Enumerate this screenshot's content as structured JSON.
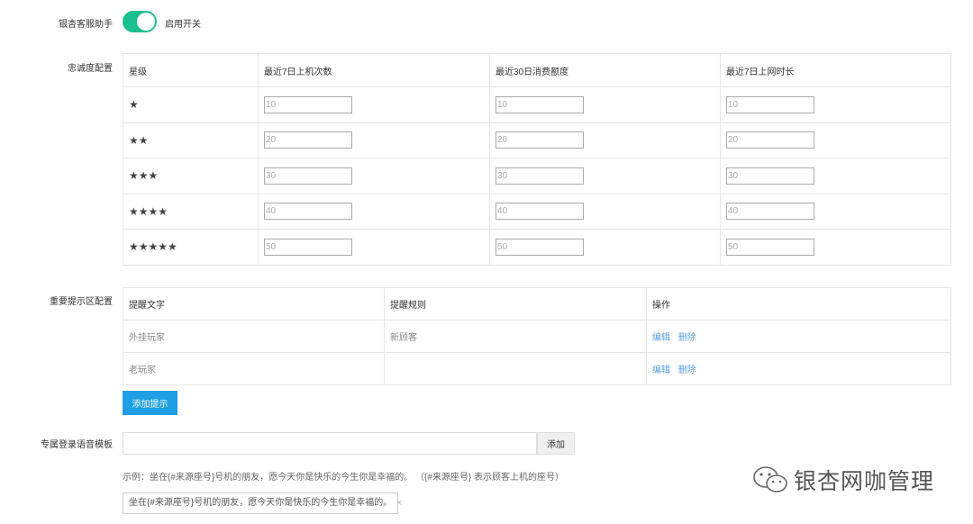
{
  "assistant": {
    "label": "银杏客服助手",
    "toggle_text": "启用开关",
    "enabled": true
  },
  "loyalty": {
    "label": "忠诚度配置",
    "headers": [
      "星级",
      "最近7日上机次数",
      "最近30日消费额度",
      "最近7日上网时长"
    ],
    "rows": [
      {
        "stars": "★",
        "v1": "10",
        "v2": "10",
        "v3": "10"
      },
      {
        "stars": "★★",
        "v1": "20",
        "v2": "20",
        "v3": "20"
      },
      {
        "stars": "★★★",
        "v1": "30",
        "v2": "30",
        "v3": "30"
      },
      {
        "stars": "★★★★",
        "v1": "40",
        "v2": "40",
        "v3": "40"
      },
      {
        "stars": "★★★★★",
        "v1": "50",
        "v2": "50",
        "v3": "50"
      }
    ]
  },
  "reminder": {
    "label": "重要提示区配置",
    "headers": [
      "提醒文字",
      "提醒规则",
      "操作"
    ],
    "rows": [
      {
        "text": "外挂玩家",
        "rule": "新顾客",
        "edit": "编辑",
        "delete": "删除"
      },
      {
        "text": "老玩家",
        "rule": "",
        "edit": "编辑",
        "delete": "删除"
      }
    ],
    "add_button": "添加提示"
  },
  "voice_template": {
    "label": "专属登录语音模板",
    "input_value": "",
    "add_button": "添加",
    "example": "示例：坐在{#来源座号}号机的朋友，愿今天你是快乐的今生你是幸福的。 （{#来源座号} 表示顾客上机的座号）",
    "tag": "坐在{#来源座号}号机的朋友，愿今天你是快乐的今生你是幸福的。",
    "tag_close": "×"
  },
  "watermark": {
    "text": "银杏网咖管理",
    "icon": "wechat-icon"
  },
  "colors": {
    "toggle_on": "#1cbf8e",
    "primary": "#1e9fe3",
    "link": "#5aa0e0"
  }
}
